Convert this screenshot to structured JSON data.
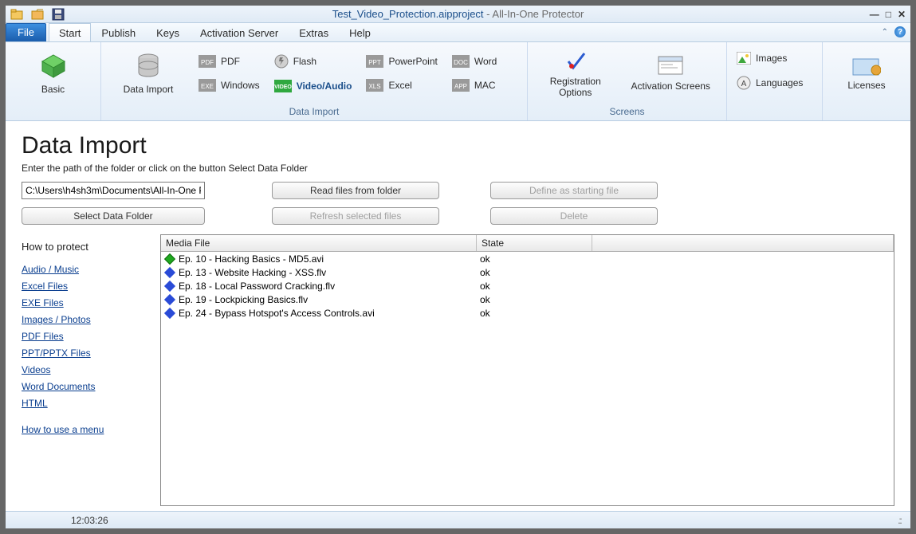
{
  "title": {
    "project": "Test_Video_Protection.aipproject",
    "app": "- All-In-One Protector"
  },
  "menu": {
    "file": "File",
    "tabs": [
      "Start",
      "Publish",
      "Keys",
      "Activation Server",
      "Extras",
      "Help"
    ]
  },
  "ribbon": {
    "basic": "Basic",
    "data_import": "Data Import",
    "group_data_import": "Data Import",
    "group_screens": "Screens",
    "items": {
      "pdf": "PDF",
      "windows": "Windows",
      "flash": "Flash",
      "video": "Video/Audio",
      "powerpoint": "PowerPoint",
      "excel": "Excel",
      "word": "Word",
      "mac": "MAC",
      "registration": "Registration\nOptions",
      "activation": "Activation Screens",
      "images": "Images",
      "languages": "Languages",
      "licenses": "Licenses"
    }
  },
  "page": {
    "heading": "Data Import",
    "sub": "Enter the path of the folder or click on the button Select Data Folder",
    "path_value": "C:\\Users\\h4sh3m\\Documents\\All-In-One Pr",
    "btn_read": "Read files from folder",
    "btn_select": "Select Data Folder",
    "btn_refresh": "Refresh selected files",
    "btn_define": "Define as starting file",
    "btn_delete": "Delete"
  },
  "sidebar": {
    "heading": "How to protect",
    "links": [
      "Audio / Music",
      "Excel Files",
      "EXE Files",
      "Images / Photos",
      "PDF Files",
      "PPT/PPTX Files",
      "Videos",
      "Word Documents",
      "HTML"
    ],
    "howto": "How to use a menu"
  },
  "table": {
    "cols": {
      "c1": "Media File",
      "c2": "State"
    },
    "rows": [
      {
        "file": "Ep. 10 - Hacking Basics - MD5.avi",
        "state": "ok",
        "icon": "green"
      },
      {
        "file": "Ep. 13 - Website Hacking - XSS.flv",
        "state": "ok",
        "icon": "blue"
      },
      {
        "file": "Ep. 18 - Local Password Cracking.flv",
        "state": "ok",
        "icon": "blue"
      },
      {
        "file": "Ep. 19 - Lockpicking Basics.flv",
        "state": "ok",
        "icon": "blue"
      },
      {
        "file": "Ep. 24 - Bypass Hotspot's Access Controls.avi",
        "state": "ok",
        "icon": "blue"
      }
    ]
  },
  "status": {
    "time": "12:03:26"
  }
}
